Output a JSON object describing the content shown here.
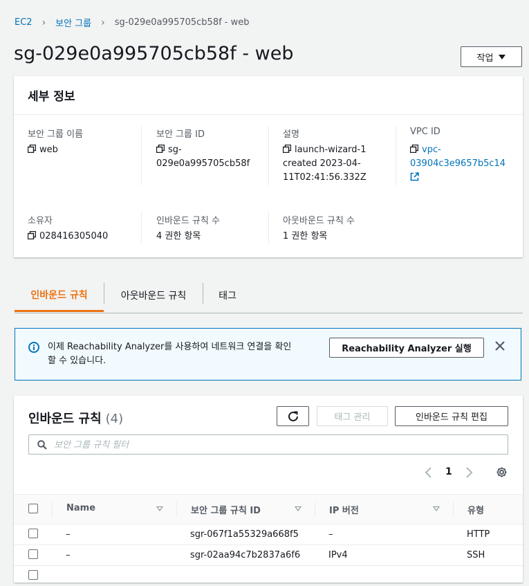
{
  "breadcrumb": {
    "items": [
      "EC2",
      "보안 그룹"
    ],
    "current": "sg-029e0a995705cb58f - web"
  },
  "page_title": "sg-029e0a995705cb58f - web",
  "actions_label": "작업",
  "details": {
    "heading": "세부 정보",
    "fields": {
      "name": {
        "label": "보안 그룹 이름",
        "value": "web"
      },
      "id": {
        "label": "보안 그룹 ID",
        "value_line1": "sg-",
        "value_line2": "029e0a995705cb58f"
      },
      "desc": {
        "label": "설명",
        "line1": "launch-wizard-1",
        "line2": "created 2023-04-",
        "line3": "11T02:41:56.332Z"
      },
      "vpc": {
        "label": "VPC ID",
        "line1": "vpc-",
        "line2": "03904c3e9657b5c14"
      },
      "owner": {
        "label": "소유자",
        "value": "028416305040"
      },
      "inbound_count": {
        "label": "인바운드 규칙 수",
        "value": "4 권한 항목"
      },
      "outbound_count": {
        "label": "아웃바운드 규칙 수",
        "value": "1 권한 항목"
      }
    }
  },
  "tabs": [
    "인바운드 규칙",
    "아웃바운드 규칙",
    "태그"
  ],
  "alert": {
    "line1": "이제 Reachability Analyzer를 사용하여 네트워크 연결을 확인",
    "line2": "할 수 있습니다.",
    "button": "Reachability Analyzer 실행"
  },
  "rules": {
    "title": "인바운드 규칙",
    "count": "(4)",
    "manage_tags": "태그 관리",
    "edit_rules": "인바운드 규칙 편집",
    "filter_placeholder": "보안 그룹 규칙 필터",
    "page": "1",
    "columns": [
      "Name",
      "보안 그룹 규칙 ID",
      "IP 버전",
      "유형"
    ],
    "rows": [
      {
        "name": "–",
        "rule_id": "sgr-067f1a55329a668f5",
        "ip_version": "–",
        "type": "HTTP"
      },
      {
        "name": "–",
        "rule_id": "sgr-02aa94c7b2837a6f6",
        "ip_version": "IPv4",
        "type": "SSH"
      }
    ]
  },
  "colors": {
    "link": "#0073bb",
    "accent": "#ec7211",
    "info": "#0073bb"
  }
}
